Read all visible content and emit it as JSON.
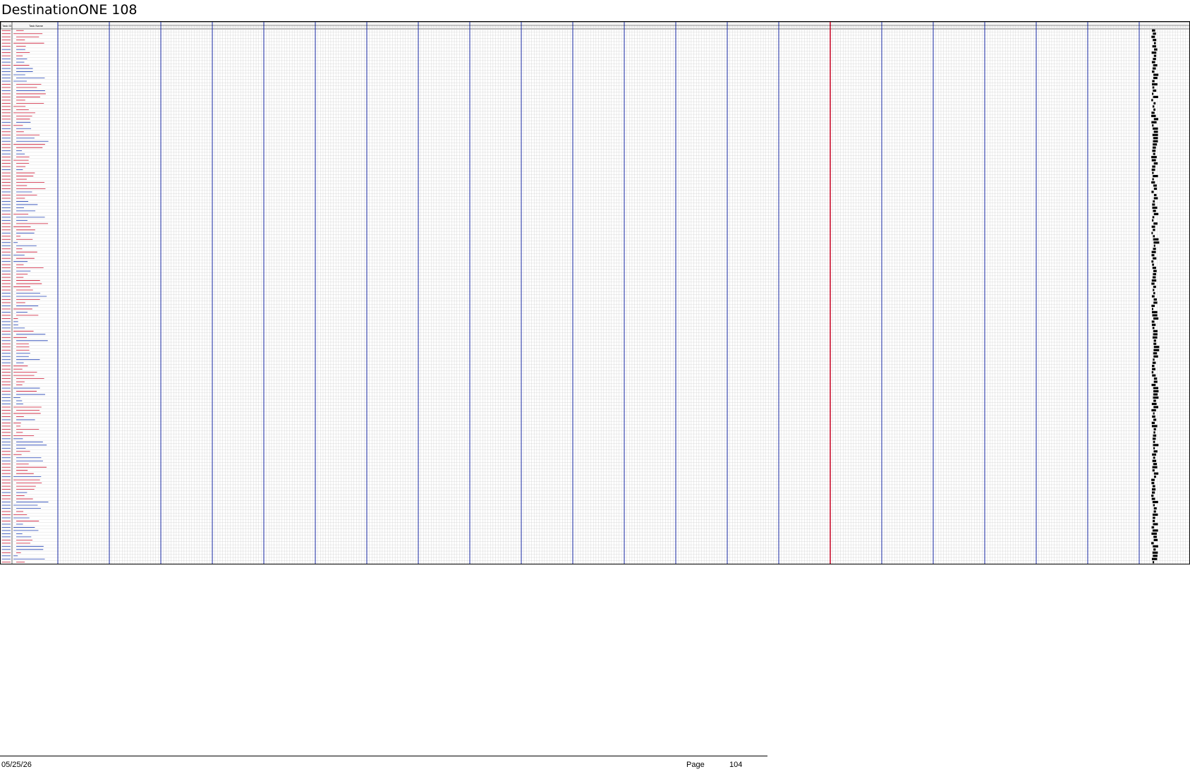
{
  "document": {
    "title": "DestinationONE 108"
  },
  "table": {
    "header": {
      "col_id": "Task ID",
      "col_name": "Task Name"
    },
    "row_count": 169,
    "month_count": 22,
    "today_marker_month": 15
  },
  "colors": {
    "grid": "#c8c8c8",
    "month_divider": "#2a3aa8",
    "today_line": "#c8102e",
    "task_blue": "#1f3fb0",
    "task_red": "#c8102e",
    "bar": "#000000"
  },
  "footer": {
    "date": "05/25/26",
    "page_label": "Page",
    "page_number": "104"
  }
}
